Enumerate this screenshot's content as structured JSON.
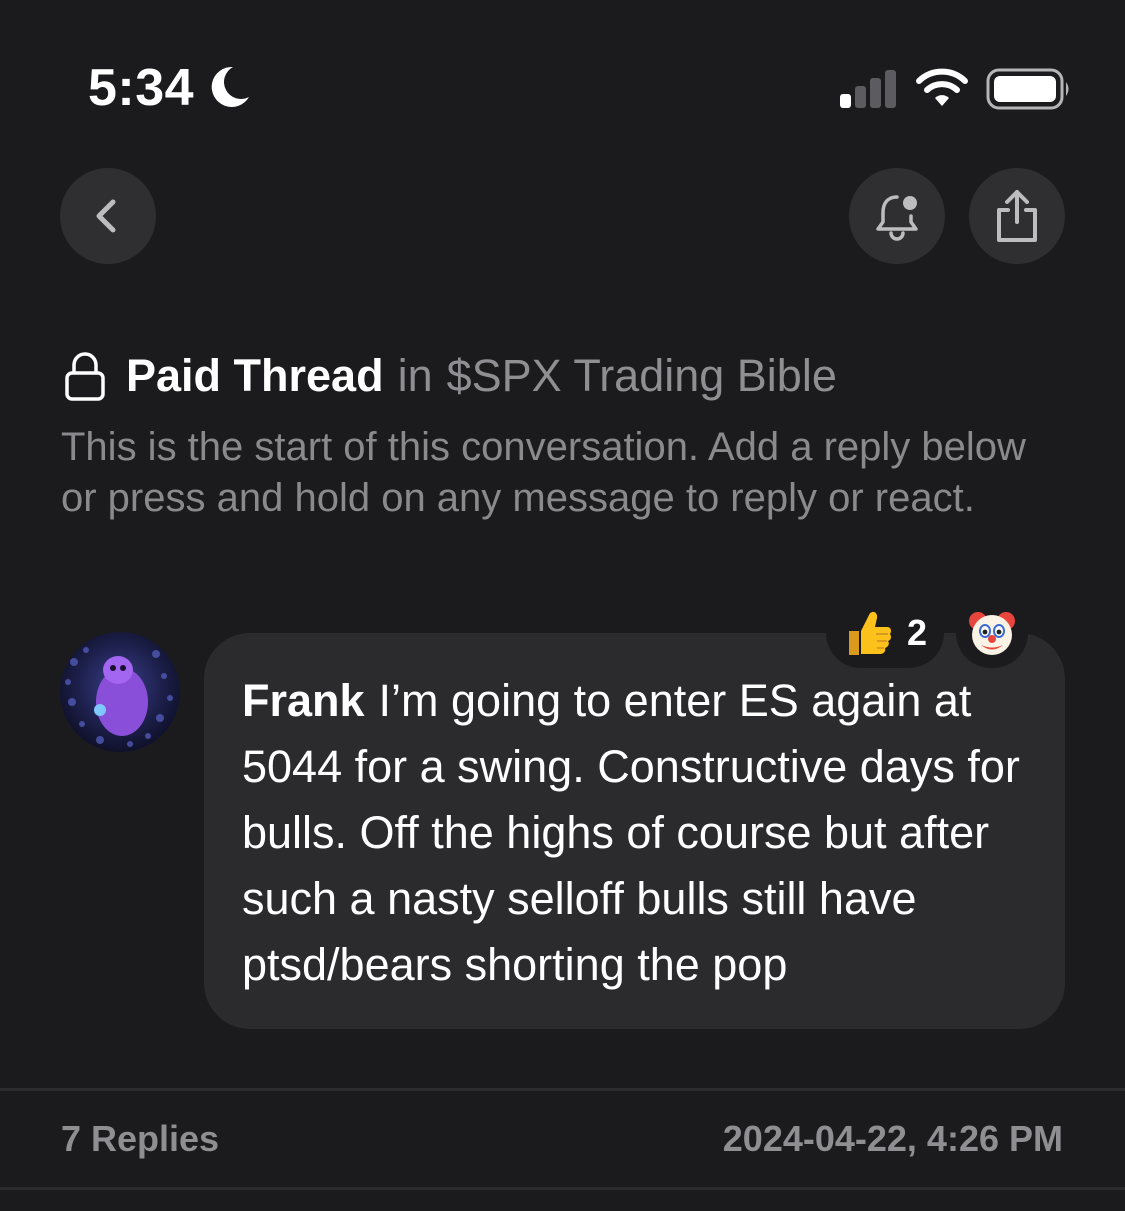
{
  "status_bar": {
    "time": "5:34",
    "focus_icon": "moon-icon",
    "signal_icon": "cellular-signal-icon",
    "wifi_icon": "wifi-icon",
    "battery_icon": "battery-icon"
  },
  "nav": {
    "back_icon": "chevron-left-icon",
    "notify_icon": "bell-badge-icon",
    "share_icon": "share-icon"
  },
  "thread": {
    "lock_icon": "lock-icon",
    "title": "Paid Thread",
    "in_label": "in",
    "community": "$SPX Trading Bible",
    "description": "This is the start of this conversation. Add a reply below or press and hold on any message to reply or react."
  },
  "message": {
    "author": "Frank",
    "text": "I’m going to enter ES again at 5044 for a swing. Constructive days for bulls. Off the highs of course but after such a nasty selloff bulls still have ptsd/bears shorting the pop",
    "reactions": [
      {
        "emoji": "👍",
        "count": "2"
      },
      {
        "emoji": "🤡"
      }
    ]
  },
  "footer": {
    "replies": "7 Replies",
    "timestamp": "2024-04-22, 4:26 PM"
  },
  "colors": {
    "background": "#1b1b1d",
    "bubble": "#2b2b2e",
    "button": "#2f2f32",
    "muted_text": "#8e8e93"
  }
}
